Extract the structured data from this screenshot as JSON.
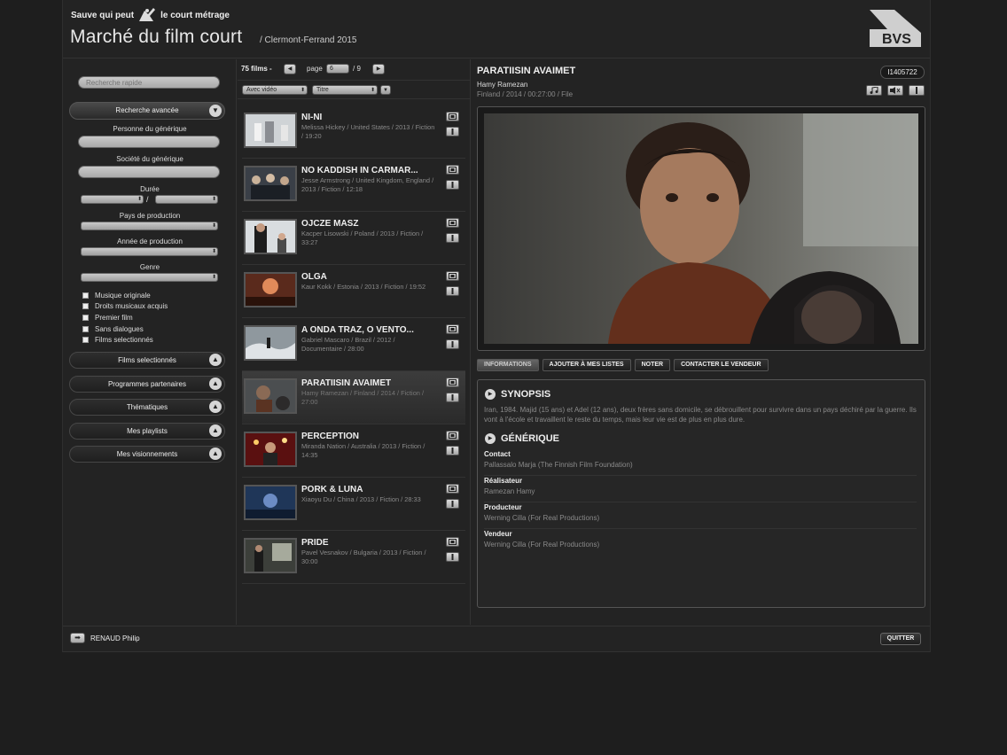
{
  "header": {
    "brand_a": "Sauve qui peut",
    "brand_b": "le court métrage",
    "title": "Marché du film court",
    "subtitle": "/ Clermont-Ferrand 2015",
    "logo_text": "BVS"
  },
  "search": {
    "placeholder": "Recherche rapide",
    "advanced_label": "Recherche avancée"
  },
  "filters": {
    "person_label": "Personne du générique",
    "company_label": "Société du générique",
    "duration_label": "Durée",
    "duration_sep": "/",
    "country_label": "Pays de production",
    "year_label": "Année de production",
    "genre_label": "Genre",
    "checks": [
      "Musique originale",
      "Droits musicaux acquis",
      "Premier film",
      "Sans dialogues",
      "Films selectionnés"
    ]
  },
  "sections": [
    "Films selectionnés",
    "Programmes partenaires",
    "Thématiques",
    "Mes playlists",
    "Mes visionnements"
  ],
  "list": {
    "count": "75 films -",
    "page_label": "page",
    "page": "6",
    "total": "/ 9",
    "filter_video": "Avec vidéo",
    "filter_sort": "Titre",
    "films": [
      {
        "title": "NI-NI",
        "meta": "Melissa Hickey / United States / 2013 / Fiction / 19:20"
      },
      {
        "title": "NO KADDISH IN CARMAR...",
        "meta": "Jesse Armstrong / United Kingdom, England / 2013 / Fiction / 12:18"
      },
      {
        "title": "OJCZE MASZ",
        "meta": "Kacper Lisowski / Poland / 2013 / Fiction / 33:27"
      },
      {
        "title": "OLGA",
        "meta": "Kaur Kokk / Estonia / 2013 / Fiction / 19:52"
      },
      {
        "title": "A ONDA TRAZ, O VENTO...",
        "meta": "Gabriel Mascaro / Brazil / 2012 / Documentaire / 28:00"
      },
      {
        "title": "PARATIISIN AVAIMET",
        "meta": "Hamy Ramezan / Finland / 2014 / Fiction / 27:00"
      },
      {
        "title": "PERCEPTION",
        "meta": "Miranda Nation / Australia / 2013 / Fiction / 14:35"
      },
      {
        "title": "PORK & LUNA",
        "meta": "Xiaoyu Du / China / 2013 / Fiction / 28:33"
      },
      {
        "title": "PRIDE",
        "meta": "Pavel Vesnakov / Bulgaria / 2013 / Fiction / 30:00"
      }
    ]
  },
  "detail": {
    "title": "PARATIISIN AVAIMET",
    "id": "I1405722",
    "director": "Hamy Ramezan",
    "meta": "Finland / 2014 / 00:27:00 / File",
    "tabs": [
      "INFORMATIONS",
      "AJOUTER À MES LISTES",
      "NOTER",
      "CONTACTER LE VENDEUR"
    ],
    "synopsis_title": "SYNOPSIS",
    "synopsis": "Iran, 1984. Majid (15 ans) et Adel (12 ans), deux frères sans domicile, se débrouillent pour survivre dans un pays déchiré par la guerre. Ils vont à l'école et travaillent le reste du temps, mais leur vie est de plus en plus dure.",
    "credits_title": "GÉNÉRIQUE",
    "credits": [
      {
        "role": "Contact",
        "person": "Pallassalo Marja (The Finnish Film Foundation)"
      },
      {
        "role": "Réalisateur",
        "person": "Ramezan Hamy"
      },
      {
        "role": "Producteur",
        "person": "Werning Cilla (For Real Productions)"
      },
      {
        "role": "Vendeur",
        "person": "Werning Cilla (For Real Productions)"
      }
    ]
  },
  "footer": {
    "user": "RENAUD Philip",
    "quit": "QUITTER"
  },
  "icons": {
    "search": "magnifier",
    "expand": "chevron-down-icon",
    "collapse": "chevron-up-icon",
    "film": "film-icon",
    "info": "info-icon",
    "music": "music-icon",
    "subtitles": "subtitles-icon",
    "play": "play-icon",
    "logout": "arrow-right-icon"
  },
  "colors": {
    "background": "#1e1e1e",
    "panel": "#232323",
    "accent_o": "#e84a2a"
  }
}
